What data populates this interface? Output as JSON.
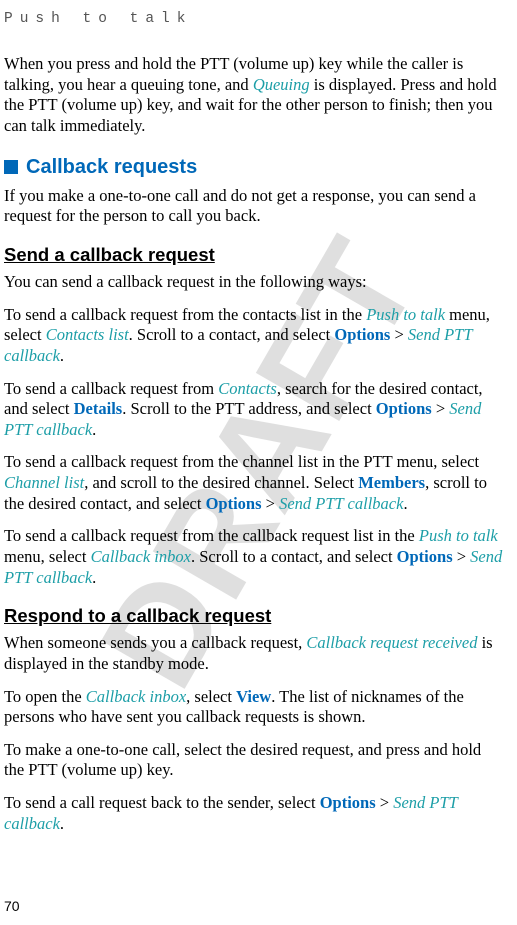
{
  "header": {
    "title": "Push to talk"
  },
  "watermark": "DRAFT",
  "intro": {
    "t1": "When you press and hold the PTT (volume up) key while the caller is talking, you hear a queuing tone, and ",
    "queuing": "Queuing",
    "t2": " is displayed. Press and hold the PTT (volume up) key, and wait for the other person to finish; then you can talk immediately."
  },
  "section": {
    "title": "Callback requests"
  },
  "s_intro": "If you make a one-to-one call and do not get a response, you can send a request for the person to call you back.",
  "sub1": {
    "title": "Send a callback request"
  },
  "p1": "You can send a callback request in the following ways:",
  "p2": {
    "t1": "To send a callback request from the contacts list in the ",
    "ptt": "Push to talk",
    "t2": " menu, select ",
    "cl": "Contacts list",
    "t3": ". Scroll to a contact, and select ",
    "opt": "Options",
    "gt": " > ",
    "spc": "Send PTT callback",
    "t4": "."
  },
  "p3": {
    "t1": "To send a callback request from ",
    "contacts": "Contacts",
    "t2": ", search for the desired contact, and select ",
    "details": "Details",
    "t3": ". Scroll to the PTT address, and select ",
    "opt": "Options",
    "gt": " > ",
    "spc": "Send PTT callback",
    "t4": "."
  },
  "p4": {
    "t1": "To send a callback request from the channel list in the PTT menu, select ",
    "chlist": "Channel list",
    "t2": ", and scroll to the desired channel. Select ",
    "members": "Members",
    "t3": ", scroll to the desired contact, and select ",
    "opt": "Options",
    "gt": " > ",
    "spc": "Send PTT callback",
    "t4": "."
  },
  "p5": {
    "t1": "To send a callback request from the callback request list in the ",
    "ptt": "Push to talk",
    "t2": " menu, select ",
    "cbi": "Callback inbox",
    "t3": ". Scroll to a contact, and select ",
    "opt": "Options",
    "gt": " > ",
    "spc": "Send PTT callback",
    "t4": "."
  },
  "sub2": {
    "title": "Respond to a callback request"
  },
  "r1": {
    "t1": "When someone sends you a callback request, ",
    "crr": "Callback request received",
    "t2": " is displayed in the standby mode."
  },
  "r2": {
    "t1": "To open the ",
    "cbi": "Callback inbox",
    "t2": ", select ",
    "view": "View",
    "t3": ". The list of nicknames of the persons who have sent you callback requests is shown."
  },
  "r3": "To make a one-to-one call, select the desired request, and press and hold the PTT (volume up) key.",
  "r4": {
    "t1": "To send a call request back to the sender, select ",
    "opt": "Options",
    "gt": " > ",
    "spc": "Send PTT callback",
    "t2": "."
  },
  "page": "70"
}
